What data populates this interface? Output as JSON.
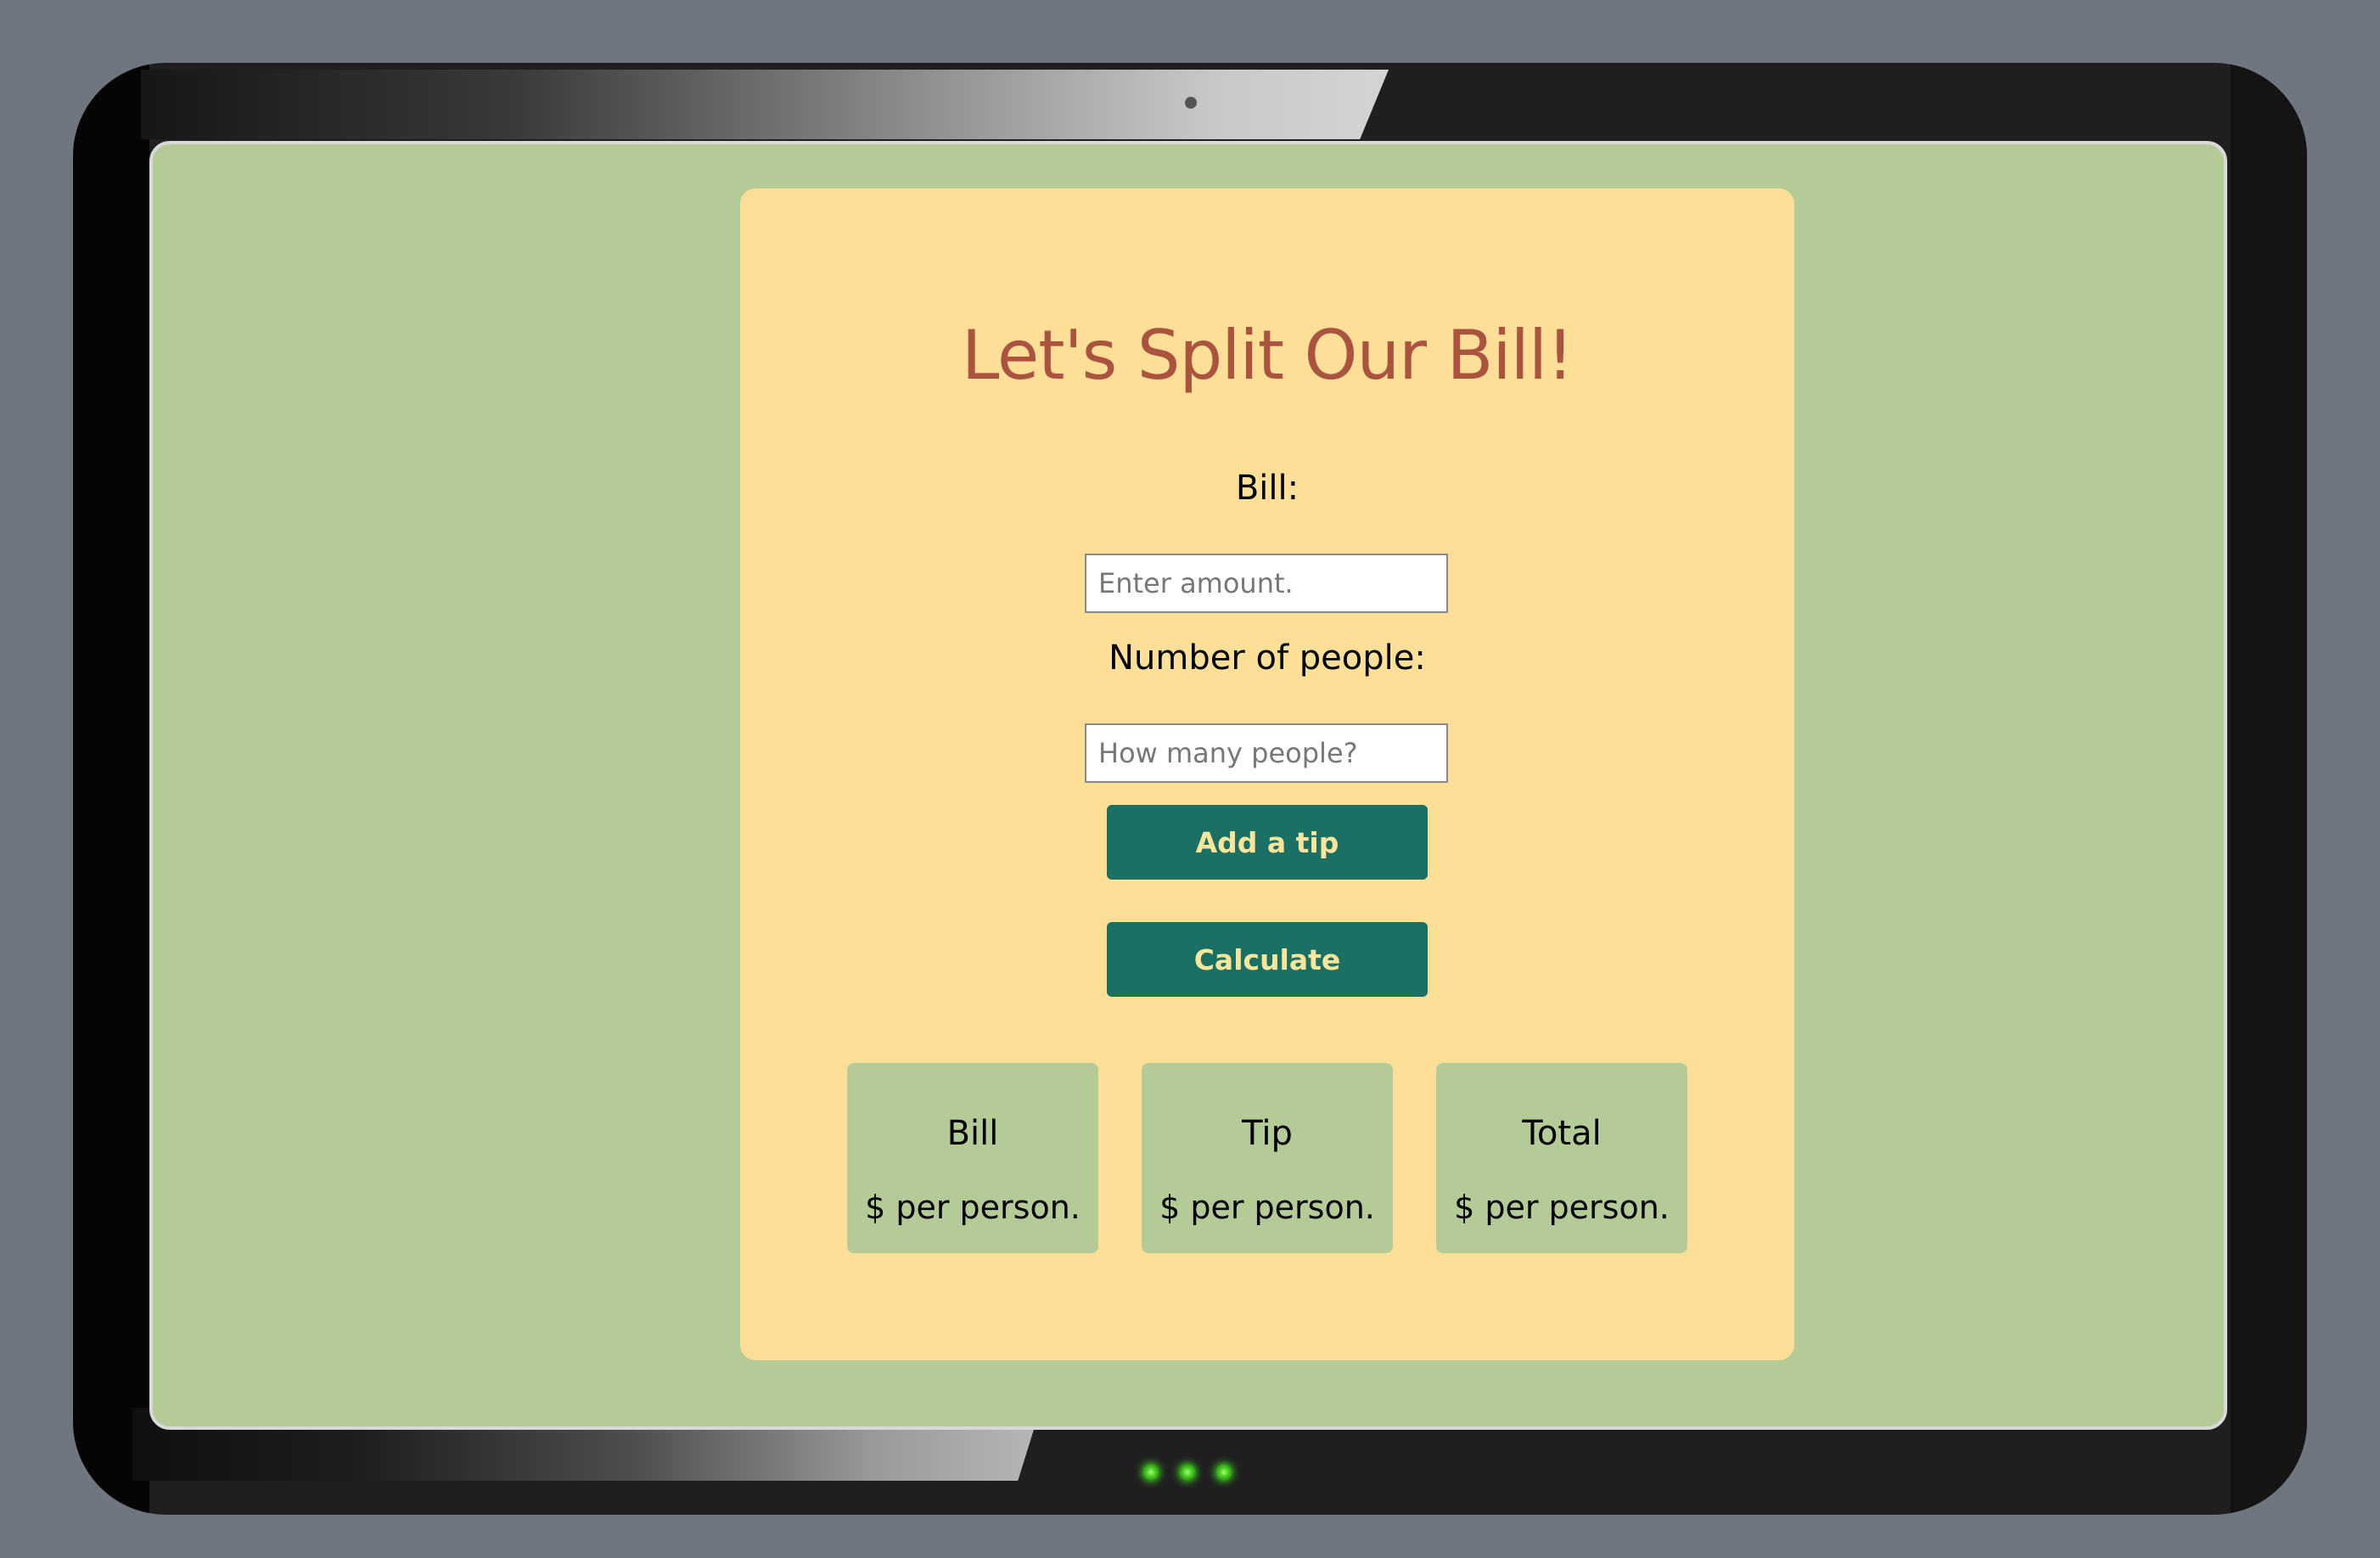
{
  "app": {
    "title": "Let's Split Our Bill!"
  },
  "form": {
    "bill_label": "Bill:",
    "bill_placeholder": "Enter amount.",
    "people_label": "Number of people:",
    "people_placeholder": "How many people?",
    "tip_button": "Add a tip",
    "calculate_button": "Calculate"
  },
  "results": [
    {
      "title": "Bill",
      "value": "$ per person."
    },
    {
      "title": "Tip",
      "value": "$ per person."
    },
    {
      "title": "Total",
      "value": "$ per person."
    }
  ],
  "colors": {
    "page_background": "#6f7680",
    "screen_background": "#b4cb98",
    "card_background": "#fddf98",
    "title_color": "#aa5440",
    "button_background": "#1a7065",
    "button_text": "#fde59a"
  }
}
